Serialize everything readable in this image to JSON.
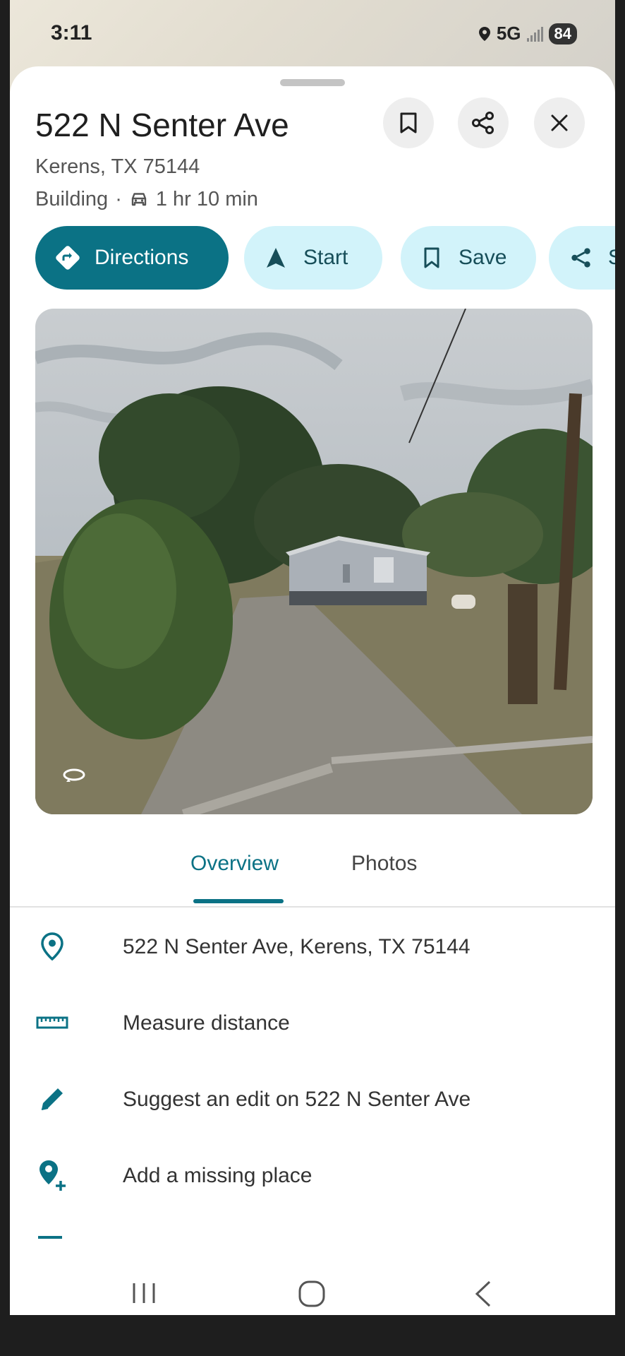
{
  "status_bar": {
    "time": "3:11",
    "network": "5G",
    "battery": "84"
  },
  "place": {
    "title": "522 N Senter Ave",
    "locality": "Kerens, TX 75144",
    "category": "Building",
    "separator": "·",
    "drive_time": "1 hr 10 min"
  },
  "header_actions": [
    "bookmark-icon",
    "share-icon",
    "close-icon"
  ],
  "chips": [
    {
      "label": "Directions",
      "icon": "directions-icon"
    },
    {
      "label": "Start",
      "icon": "navigation-arrow-icon"
    },
    {
      "label": "Save",
      "icon": "bookmark-icon"
    },
    {
      "label": "Sh",
      "icon": "share-icon"
    }
  ],
  "photo": {
    "type": "street-view",
    "overlay_icon": "street-view-360-icon"
  },
  "tabs": [
    {
      "label": "Overview",
      "active": true
    },
    {
      "label": "Photos",
      "active": false
    }
  ],
  "info_rows": [
    {
      "label": "522 N Senter Ave, Kerens, TX 75144",
      "icon": "location-pin-icon"
    },
    {
      "label": "Measure distance",
      "icon": "ruler-icon"
    },
    {
      "label": "Suggest an edit on 522 N Senter Ave",
      "icon": "pencil-icon"
    },
    {
      "label": "Add a missing place",
      "icon": "add-location-icon"
    }
  ],
  "colors": {
    "accent": "#0b7285",
    "chip_secondary_bg": "#d2f3fa",
    "chip_secondary_text": "#174e59"
  },
  "nav_bar": [
    "recents-icon",
    "home-icon",
    "back-icon"
  ]
}
